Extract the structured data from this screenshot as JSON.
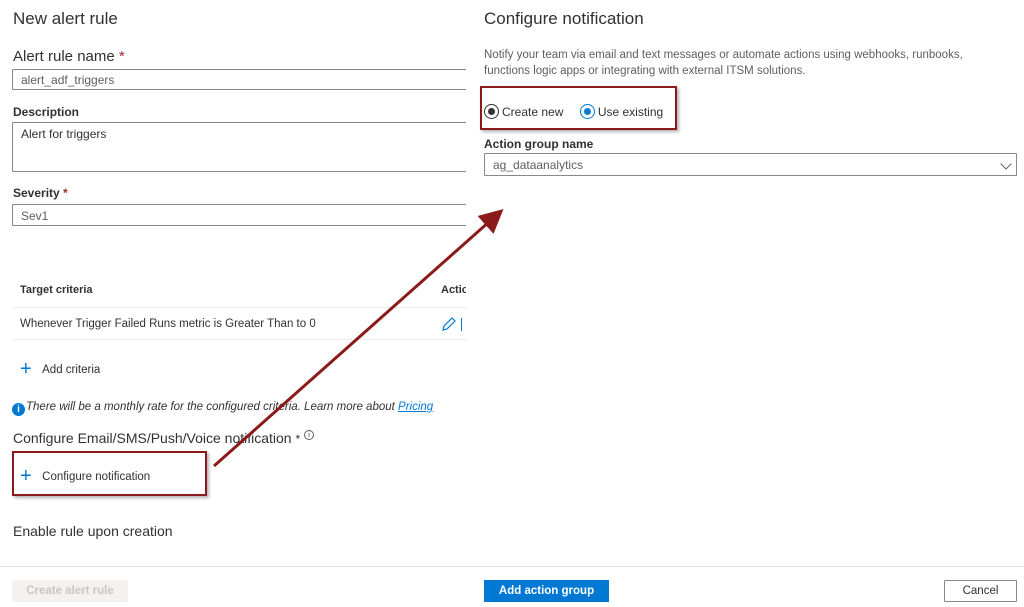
{
  "left_panel": {
    "title": "New alert rule",
    "alert_rule_name": {
      "label": "Alert rule name",
      "required": "*",
      "value": "alert_adf_triggers"
    },
    "description": {
      "label": "Description",
      "value": "Alert for triggers"
    },
    "severity": {
      "label": "Severity",
      "required": "*",
      "value": "Sev1"
    },
    "criteria_table": {
      "headers": [
        "Target criteria",
        "Actio"
      ],
      "rows": [
        {
          "criteria": "Whenever Trigger Failed Runs metric is Greater Than to 0"
        }
      ]
    },
    "add_criteria_label": "Add criteria",
    "info": {
      "text": "There will be a monthly rate for the configured criteria. Learn more about ",
      "link": "Pricing"
    },
    "notification_section": {
      "label": "Configure Email/SMS/Push/Voice notification",
      "required": "*"
    },
    "configure_notification_label": "Configure notification",
    "enable_rule_label": "Enable rule upon creation",
    "create_button_label": "Create alert rule"
  },
  "right_panel": {
    "title": "Configure notification",
    "description_line1": "Notify your team via email and text messages or automate actions using webhooks, runbooks,",
    "description_line2": "functions logic apps or integrating with external ITSM solutions.",
    "radio_options": [
      {
        "label": "Create new",
        "selected": false
      },
      {
        "label": "Use existing",
        "selected": true
      }
    ],
    "action_group": {
      "label": "Action group name",
      "value": "ag_dataanalytics"
    },
    "add_button_label": "Add action group",
    "cancel_button_label": "Cancel"
  },
  "annotation": {
    "color": "#8b1a1a"
  }
}
